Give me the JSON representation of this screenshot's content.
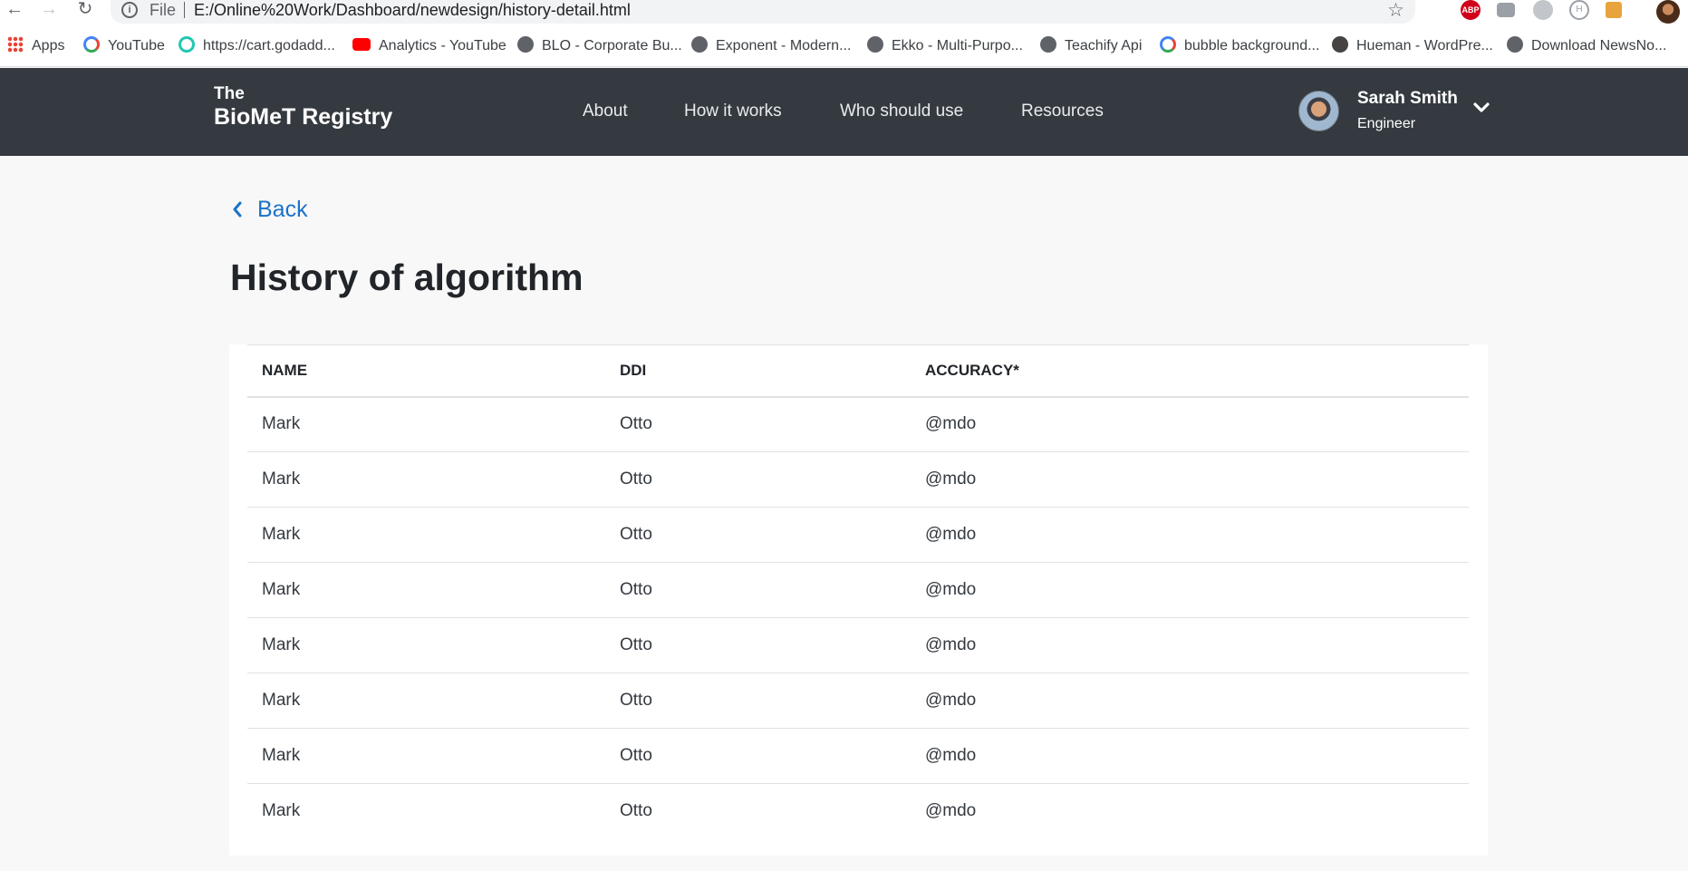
{
  "browser": {
    "url_scheme_label": "File",
    "url": "E:/Online%20Work/Dashboard/newdesign/history-detail.html",
    "extensions": [
      "ABP"
    ],
    "bookmarks": [
      {
        "label": "Apps",
        "icon": "apps-icon"
      },
      {
        "label": "YouTube",
        "icon": "google-icon"
      },
      {
        "label": "https://cart.godadd...",
        "icon": "swirl-icon"
      },
      {
        "label": "Analytics - YouTube",
        "icon": "youtube-icon"
      },
      {
        "label": "BLO - Corporate Bu...",
        "icon": "globe-icon"
      },
      {
        "label": "Exponent - Modern...",
        "icon": "globe-icon"
      },
      {
        "label": "Ekko - Multi-Purpo...",
        "icon": "globe-icon"
      },
      {
        "label": "Teachify Api",
        "icon": "globe-icon"
      },
      {
        "label": "bubble background...",
        "icon": "google-icon"
      },
      {
        "label": "Hueman - WordPre...",
        "icon": "wordpress-icon"
      },
      {
        "label": "Download NewsNo...",
        "icon": "globe-icon"
      }
    ]
  },
  "header": {
    "logo_line1": "The",
    "logo_line2": "BioMeT Registry",
    "menu": [
      "About",
      "How it works",
      "Who should use",
      "Resources"
    ],
    "user": {
      "name": "Sarah Smith",
      "role": "Engineer"
    }
  },
  "page": {
    "back_label": "Back",
    "title": "History of algorithm"
  },
  "table": {
    "columns": [
      "NAME",
      "DDI",
      "ACCURACY*"
    ],
    "rows": [
      [
        "Mark",
        "Otto",
        "@mdo"
      ],
      [
        "Mark",
        "Otto",
        "@mdo"
      ],
      [
        "Mark",
        "Otto",
        "@mdo"
      ],
      [
        "Mark",
        "Otto",
        "@mdo"
      ],
      [
        "Mark",
        "Otto",
        "@mdo"
      ],
      [
        "Mark",
        "Otto",
        "@mdo"
      ],
      [
        "Mark",
        "Otto",
        "@mdo"
      ],
      [
        "Mark",
        "Otto",
        "@mdo"
      ]
    ]
  },
  "colors": {
    "header_bg": "#343a40",
    "link": "#1a73c9",
    "page_bg": "#f8f8f8"
  }
}
